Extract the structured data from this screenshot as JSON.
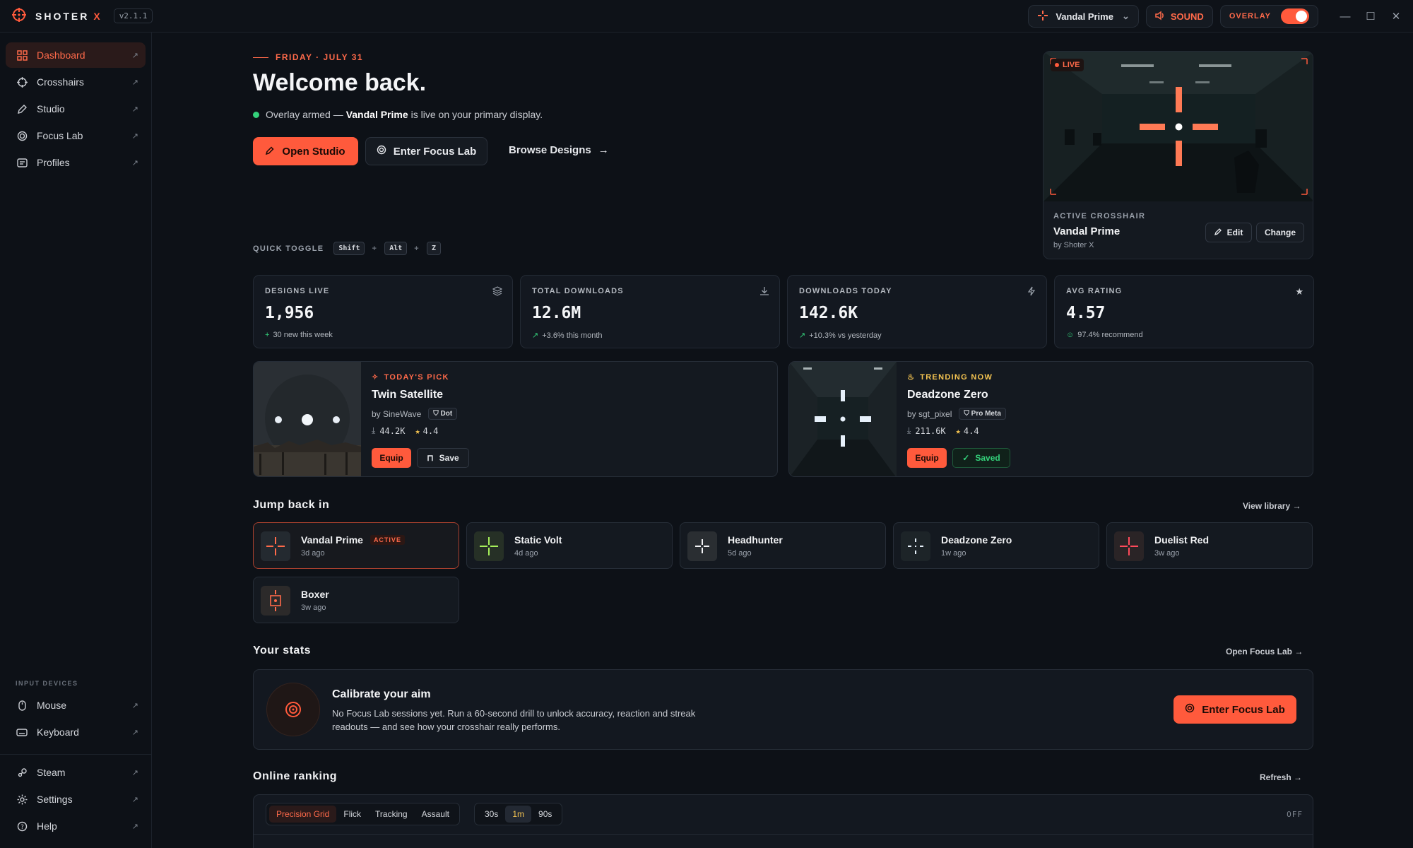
{
  "app": {
    "brand": "SHOTER",
    "brand_accent": "X",
    "version": "v2.1.1"
  },
  "titlebar": {
    "profile": "Vandal Prime",
    "sound": "SOUND",
    "overlay": "OVERLAY"
  },
  "colors": {
    "accent": "#ff5a3c",
    "positive": "#34d27b",
    "star": "#f5c451",
    "background": "#0d1117"
  },
  "sidebar": {
    "items": [
      {
        "label": "Dashboard",
        "icon": "grid-icon",
        "active": true
      },
      {
        "label": "Crosshairs",
        "icon": "crosshair-icon"
      },
      {
        "label": "Studio",
        "icon": "pencil-icon"
      },
      {
        "label": "Focus Lab",
        "icon": "target-icon"
      },
      {
        "label": "Profiles",
        "icon": "card-icon"
      }
    ],
    "devices_label": "INPUT DEVICES",
    "devices": [
      {
        "label": "Mouse",
        "icon": "mouse-icon"
      },
      {
        "label": "Keyboard",
        "icon": "keyboard-icon"
      }
    ],
    "bottom": [
      {
        "label": "Steam",
        "icon": "steam-icon"
      },
      {
        "label": "Settings",
        "icon": "gear-icon"
      },
      {
        "label": "Help",
        "icon": "help-icon"
      }
    ]
  },
  "hero": {
    "date": "FRIDAY · JULY 31",
    "title": "Welcome back.",
    "status_pre": "Overlay armed —",
    "status_name": "Vandal Prime",
    "status_post": "is live on your primary display.",
    "open_studio": "Open Studio",
    "enter_focus_lab": "Enter Focus Lab",
    "browse_designs": "Browse Designs"
  },
  "quick_toggle": {
    "label": "QUICK TOGGLE",
    "keys": [
      "Shift",
      "Alt",
      "Z"
    ]
  },
  "active_crosshair": {
    "live": "LIVE",
    "label": "ACTIVE CROSSHAIR",
    "name": "Vandal Prime",
    "by": "by Shoter X",
    "edit": "Edit",
    "change": "Change"
  },
  "stats": [
    {
      "label": "DESIGNS LIVE",
      "value": "1,956",
      "sub": "30 new this week",
      "icon": "layers-icon",
      "trend": "+"
    },
    {
      "label": "TOTAL DOWNLOADS",
      "value": "12.6M",
      "sub": "+3.6% this month",
      "icon": "download-icon",
      "trend": "↗"
    },
    {
      "label": "DOWNLOADS TODAY",
      "value": "142.6K",
      "sub": "+10.3% vs yesterday",
      "icon": "bolt-icon",
      "trend": "↗"
    },
    {
      "label": "AVG RATING",
      "value": "4.57",
      "sub": "97.4% recommend",
      "icon": "star-icon",
      "trend": "☺"
    }
  ],
  "picks": [
    {
      "tag": "TODAY'S PICK",
      "name": "Twin Satellite",
      "by": "by SineWave",
      "chip": "Dot",
      "downloads": "44.2K",
      "rating": "4.4",
      "equip": "Equip",
      "save": "Save"
    },
    {
      "tag": "TRENDING NOW",
      "name": "Deadzone Zero",
      "by": "by sgt_pixel",
      "chip": "Pro Meta",
      "downloads": "211.6K",
      "rating": "4.4",
      "equip": "Equip",
      "save": "Saved"
    }
  ],
  "jump": {
    "title": "Jump back in",
    "link": "View library",
    "active_badge": "ACTIVE",
    "items": [
      {
        "name": "Vandal Prime",
        "time": "3d ago",
        "active": true
      },
      {
        "name": "Static Volt",
        "time": "4d ago"
      },
      {
        "name": "Headhunter",
        "time": "5d ago"
      },
      {
        "name": "Deadzone Zero",
        "time": "1w ago"
      },
      {
        "name": "Duelist Red",
        "time": "3w ago"
      },
      {
        "name": "Boxer",
        "time": "3w ago"
      }
    ]
  },
  "your_stats": {
    "title": "Your stats",
    "link": "Open Focus Lab",
    "card_title": "Calibrate your aim",
    "card_desc": "No Focus Lab sessions yet. Run a 60-second drill to unlock accuracy, reaction and streak readouts — and see how your crosshair really performs.",
    "cta": "Enter Focus Lab"
  },
  "ranking": {
    "title": "Online ranking",
    "link": "Refresh",
    "modes": [
      "Precision Grid",
      "Flick",
      "Tracking",
      "Assault"
    ],
    "durations": [
      "30s",
      "1m",
      "90s"
    ],
    "off": "OFF"
  }
}
